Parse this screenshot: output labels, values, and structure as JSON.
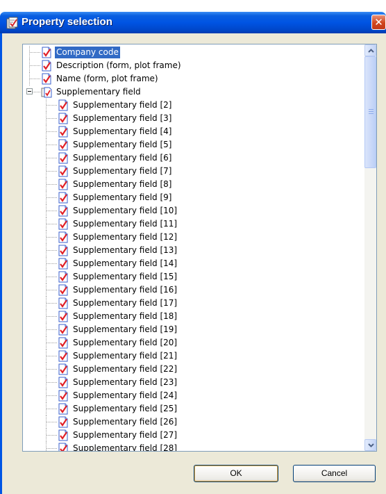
{
  "window": {
    "title": "Property selection",
    "title_icon": "properties-icon",
    "close_icon": "close-icon",
    "close_glyph": "✕"
  },
  "tree": {
    "items": [
      {
        "label": "Company code",
        "level": 0,
        "icon": "checked-document-icon",
        "selected": true
      },
      {
        "label": "Description (form, plot frame)",
        "level": 0,
        "icon": "checked-document-icon"
      },
      {
        "label": "Name (form, plot frame)",
        "level": 0,
        "icon": "checked-document-icon"
      },
      {
        "label": "Supplementary field",
        "level": 0,
        "icon": "document-group-icon",
        "expanded": true
      },
      {
        "label": "Supplementary field [2]",
        "level": 1,
        "icon": "checked-document-icon"
      },
      {
        "label": "Supplementary field [3]",
        "level": 1,
        "icon": "checked-document-icon"
      },
      {
        "label": "Supplementary field [4]",
        "level": 1,
        "icon": "checked-document-icon"
      },
      {
        "label": "Supplementary field [5]",
        "level": 1,
        "icon": "checked-document-icon"
      },
      {
        "label": "Supplementary field [6]",
        "level": 1,
        "icon": "checked-document-icon"
      },
      {
        "label": "Supplementary field [7]",
        "level": 1,
        "icon": "checked-document-icon"
      },
      {
        "label": "Supplementary field [8]",
        "level": 1,
        "icon": "checked-document-icon"
      },
      {
        "label": "Supplementary field [9]",
        "level": 1,
        "icon": "checked-document-icon"
      },
      {
        "label": "Supplementary field [10]",
        "level": 1,
        "icon": "checked-document-icon"
      },
      {
        "label": "Supplementary field [11]",
        "level": 1,
        "icon": "checked-document-icon"
      },
      {
        "label": "Supplementary field [12]",
        "level": 1,
        "icon": "checked-document-icon"
      },
      {
        "label": "Supplementary field [13]",
        "level": 1,
        "icon": "checked-document-icon"
      },
      {
        "label": "Supplementary field [14]",
        "level": 1,
        "icon": "checked-document-icon"
      },
      {
        "label": "Supplementary field [15]",
        "level": 1,
        "icon": "checked-document-icon"
      },
      {
        "label": "Supplementary field [16]",
        "level": 1,
        "icon": "checked-document-icon"
      },
      {
        "label": "Supplementary field [17]",
        "level": 1,
        "icon": "checked-document-icon"
      },
      {
        "label": "Supplementary field [18]",
        "level": 1,
        "icon": "checked-document-icon"
      },
      {
        "label": "Supplementary field [19]",
        "level": 1,
        "icon": "checked-document-icon"
      },
      {
        "label": "Supplementary field [20]",
        "level": 1,
        "icon": "checked-document-icon"
      },
      {
        "label": "Supplementary field [21]",
        "level": 1,
        "icon": "checked-document-icon"
      },
      {
        "label": "Supplementary field [22]",
        "level": 1,
        "icon": "checked-document-icon"
      },
      {
        "label": "Supplementary field [23]",
        "level": 1,
        "icon": "checked-document-icon"
      },
      {
        "label": "Supplementary field [24]",
        "level": 1,
        "icon": "checked-document-icon"
      },
      {
        "label": "Supplementary field [25]",
        "level": 1,
        "icon": "checked-document-icon"
      },
      {
        "label": "Supplementary field [26]",
        "level": 1,
        "icon": "checked-document-icon"
      },
      {
        "label": "Supplementary field [27]",
        "level": 1,
        "icon": "checked-document-icon"
      },
      {
        "label": "Supplementary field [28]",
        "level": 1,
        "icon": "checked-document-icon"
      }
    ],
    "scroll_position": 0,
    "scroll_visible_fraction": 0.28
  },
  "buttons": {
    "ok_label": "OK",
    "cancel_label": "Cancel"
  },
  "colors": {
    "title_bar": "#0054e3",
    "selection": "#316ac5",
    "dialog_background": "#ece9d8",
    "close_button": "#d1451e"
  }
}
